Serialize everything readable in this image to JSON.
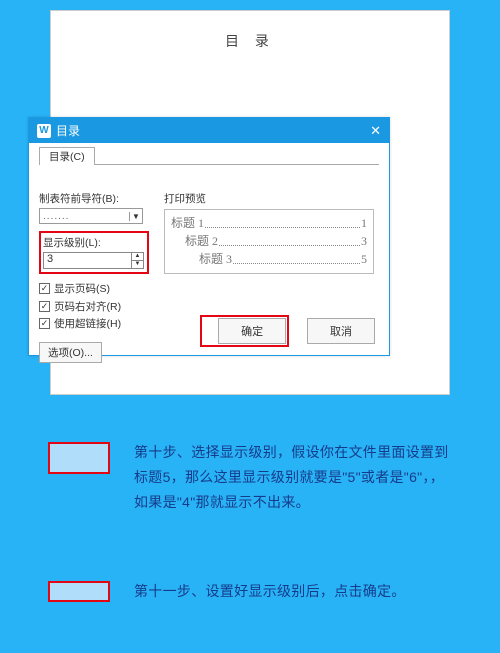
{
  "page": {
    "title": "目 录"
  },
  "dialog": {
    "title": "目录",
    "tab": "目录(C)",
    "leader_label": "制表符前导符(B):",
    "leader_value": ".......",
    "level_label": "显示级别(L):",
    "level_value": "3",
    "checks": {
      "show_page": "显示页码(S)",
      "align_right": "页码右对齐(R)",
      "hyperlinks": "使用超链接(H)"
    },
    "options_btn": "选项(O)...",
    "preview_label": "打印预览",
    "toc": [
      {
        "title": "标题 1",
        "page": "1"
      },
      {
        "title": "标题 2",
        "page": "3"
      },
      {
        "title": "标题 3",
        "page": "5"
      }
    ],
    "ok_btn": "确定",
    "cancel_btn": "取消"
  },
  "steps": {
    "s10": "第十步、选择显示级别，假设你在文件里面设置到标题5，那么这里显示级别就要是\"5\"或者是\"6\"，，如果是\"4\"那就显示不出来。",
    "s11": "第十一步、设置好显示级别后，点击确定。"
  }
}
